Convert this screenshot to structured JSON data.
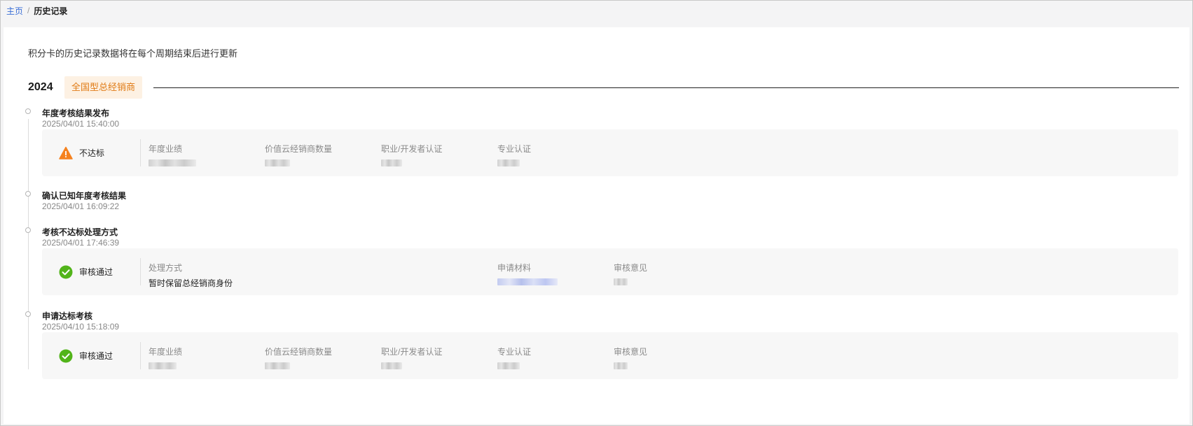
{
  "breadcrumb": {
    "home": "主页",
    "separator": "/",
    "current": "历史记录"
  },
  "notice": "积分卡的历史记录数据将在每个周期结束后进行更新",
  "year_group": {
    "year": "2024",
    "tag": "全国型总经销商"
  },
  "colors": {
    "accent_link": "#3b6fd6",
    "tag_text": "#e07b16",
    "tag_bg": "#fdf1e3",
    "warn": "#f5821f",
    "success": "#52b41a"
  },
  "events": [
    {
      "title": "年度考核结果发布",
      "time": "2025/04/01 15:40:00",
      "card": {
        "status_icon": "warning-icon",
        "status": "不达标",
        "fields": [
          {
            "label": "年度业绩"
          },
          {
            "label": "价值云经销商数量"
          },
          {
            "label": "职业/开发者认证"
          },
          {
            "label": "专业认证"
          }
        ]
      }
    },
    {
      "title": "确认已知年度考核结果",
      "time": "2025/04/01 16:09:22"
    },
    {
      "title": "考核不达标处理方式",
      "time": "2025/04/01 17:46:39",
      "card": {
        "status_icon": "check-circle-icon",
        "status": "审核通过",
        "fields": [
          {
            "label": "处理方式",
            "value": "暂时保留总经销商身份"
          },
          {
            "label": "申请材料"
          },
          {
            "label": "审核意见"
          }
        ]
      }
    },
    {
      "title": "申请达标考核",
      "time": "2025/04/10 15:18:09",
      "card": {
        "status_icon": "check-circle-icon",
        "status": "审核通过",
        "fields": [
          {
            "label": "年度业绩"
          },
          {
            "label": "价值云经销商数量"
          },
          {
            "label": "职业/开发者认证"
          },
          {
            "label": "专业认证"
          },
          {
            "label": "审核意见"
          }
        ]
      }
    }
  ]
}
